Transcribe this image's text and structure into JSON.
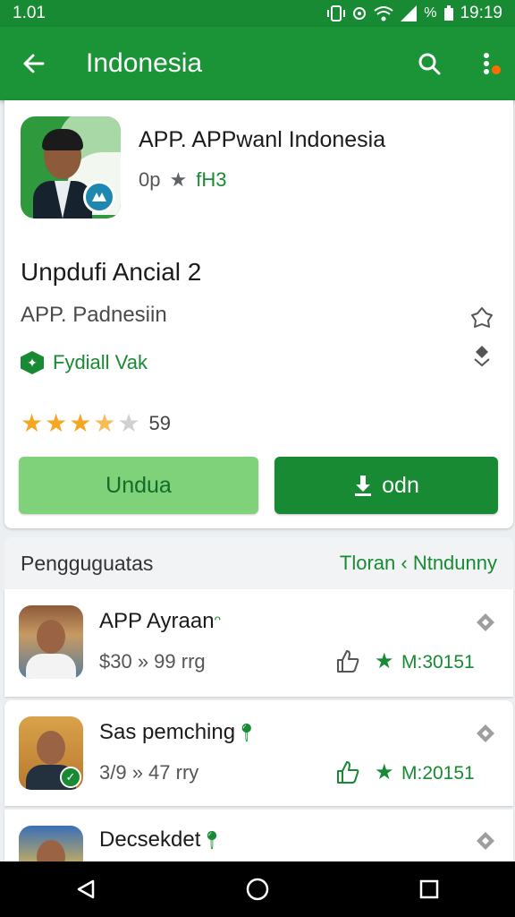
{
  "status_bar": {
    "time_left": "1.01",
    "time_right": "19:19",
    "signal_text": "%"
  },
  "app_bar": {
    "title": "Indonesia"
  },
  "app": {
    "name": "APP. APPwanl Indonesia",
    "meta_left": "0p",
    "meta_right": "fH3",
    "update_title": "Unpdufi Ancial 2",
    "publisher": "APP. Padnesiin",
    "verified_label": "Fydiall Vak",
    "rating_count": "59",
    "rating": 3.5,
    "btn_light": "Undua",
    "btn_dark": "odn"
  },
  "section": {
    "title": "Pengguguatas",
    "action": "Tloran ‹ Ntndunny"
  },
  "list": [
    {
      "title": "APP Ayraan",
      "sub": "$30 » 99 rrg",
      "code": "M:30151"
    },
    {
      "title": "Sas pemching",
      "sub": "3/9 » 47 rry",
      "code": "M:20151"
    },
    {
      "title": "Decsekdet",
      "sub": "",
      "code": ""
    }
  ],
  "colors": {
    "primary": "#1a9437",
    "status": "#178a33",
    "accent": "#ff6d00",
    "light_button": "#7fd17a",
    "star": "#f5a623"
  }
}
